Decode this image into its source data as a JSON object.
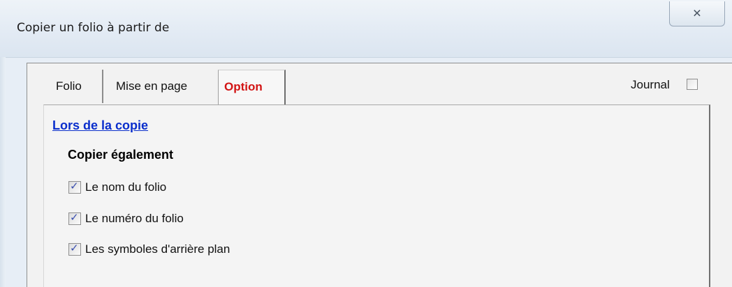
{
  "window": {
    "title": "Copier un folio à partir de",
    "close_icon": "close-icon"
  },
  "tabs": [
    {
      "label": "Folio",
      "active": false
    },
    {
      "label": "Mise en page",
      "active": false
    },
    {
      "label": "Option",
      "active": true
    }
  ],
  "journal": {
    "label": "Journal",
    "checked": false
  },
  "section": {
    "link_text": "Lors de la copie",
    "group_title": "Copier également",
    "options": [
      {
        "label": "Le nom du folio",
        "checked": true
      },
      {
        "label": "Le numéro du folio",
        "checked": true
      },
      {
        "label": "Les symboles d'arrière plan",
        "checked": true
      }
    ]
  },
  "colors": {
    "active_tab_text": "#d21414",
    "link": "#0a2ecc",
    "check_mark": "#3b4fae"
  }
}
